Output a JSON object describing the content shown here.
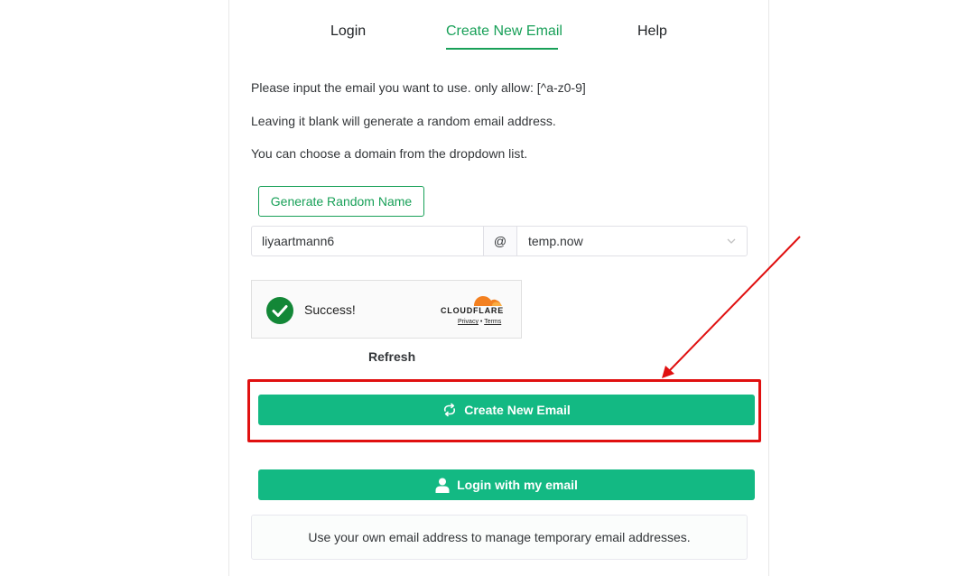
{
  "tabs": [
    {
      "label": "Login",
      "active": false
    },
    {
      "label": "Create New Email",
      "active": true
    },
    {
      "label": "Help",
      "active": false
    }
  ],
  "info": {
    "line1": "Please input the email you want to use. only allow: [^a-z0-9]",
    "line2": "Leaving it blank will generate a random email address.",
    "line3": "You can choose a domain from the dropdown list."
  },
  "generate_button": "Generate Random Name",
  "email_form": {
    "name_value": "liyaartmann6",
    "at_symbol": "@",
    "domain_selected": "temp.now"
  },
  "captcha": {
    "status": "Success!",
    "brand": "CLOUDFLARE",
    "privacy": "Privacy",
    "separator": "•",
    "terms": "Terms"
  },
  "refresh_label": "Refresh",
  "create_button": {
    "label": "Create New Email",
    "icon": "refresh-arrow-icon"
  },
  "login_button": {
    "label": "Login with my email",
    "icon": "user-icon"
  },
  "note": "Use your own email address to manage temporary email addresses.",
  "colors": {
    "accent": "#18a058",
    "button_bg": "#13b983",
    "highlight": "#e01010",
    "cloudflare_orange": "#f38020"
  }
}
